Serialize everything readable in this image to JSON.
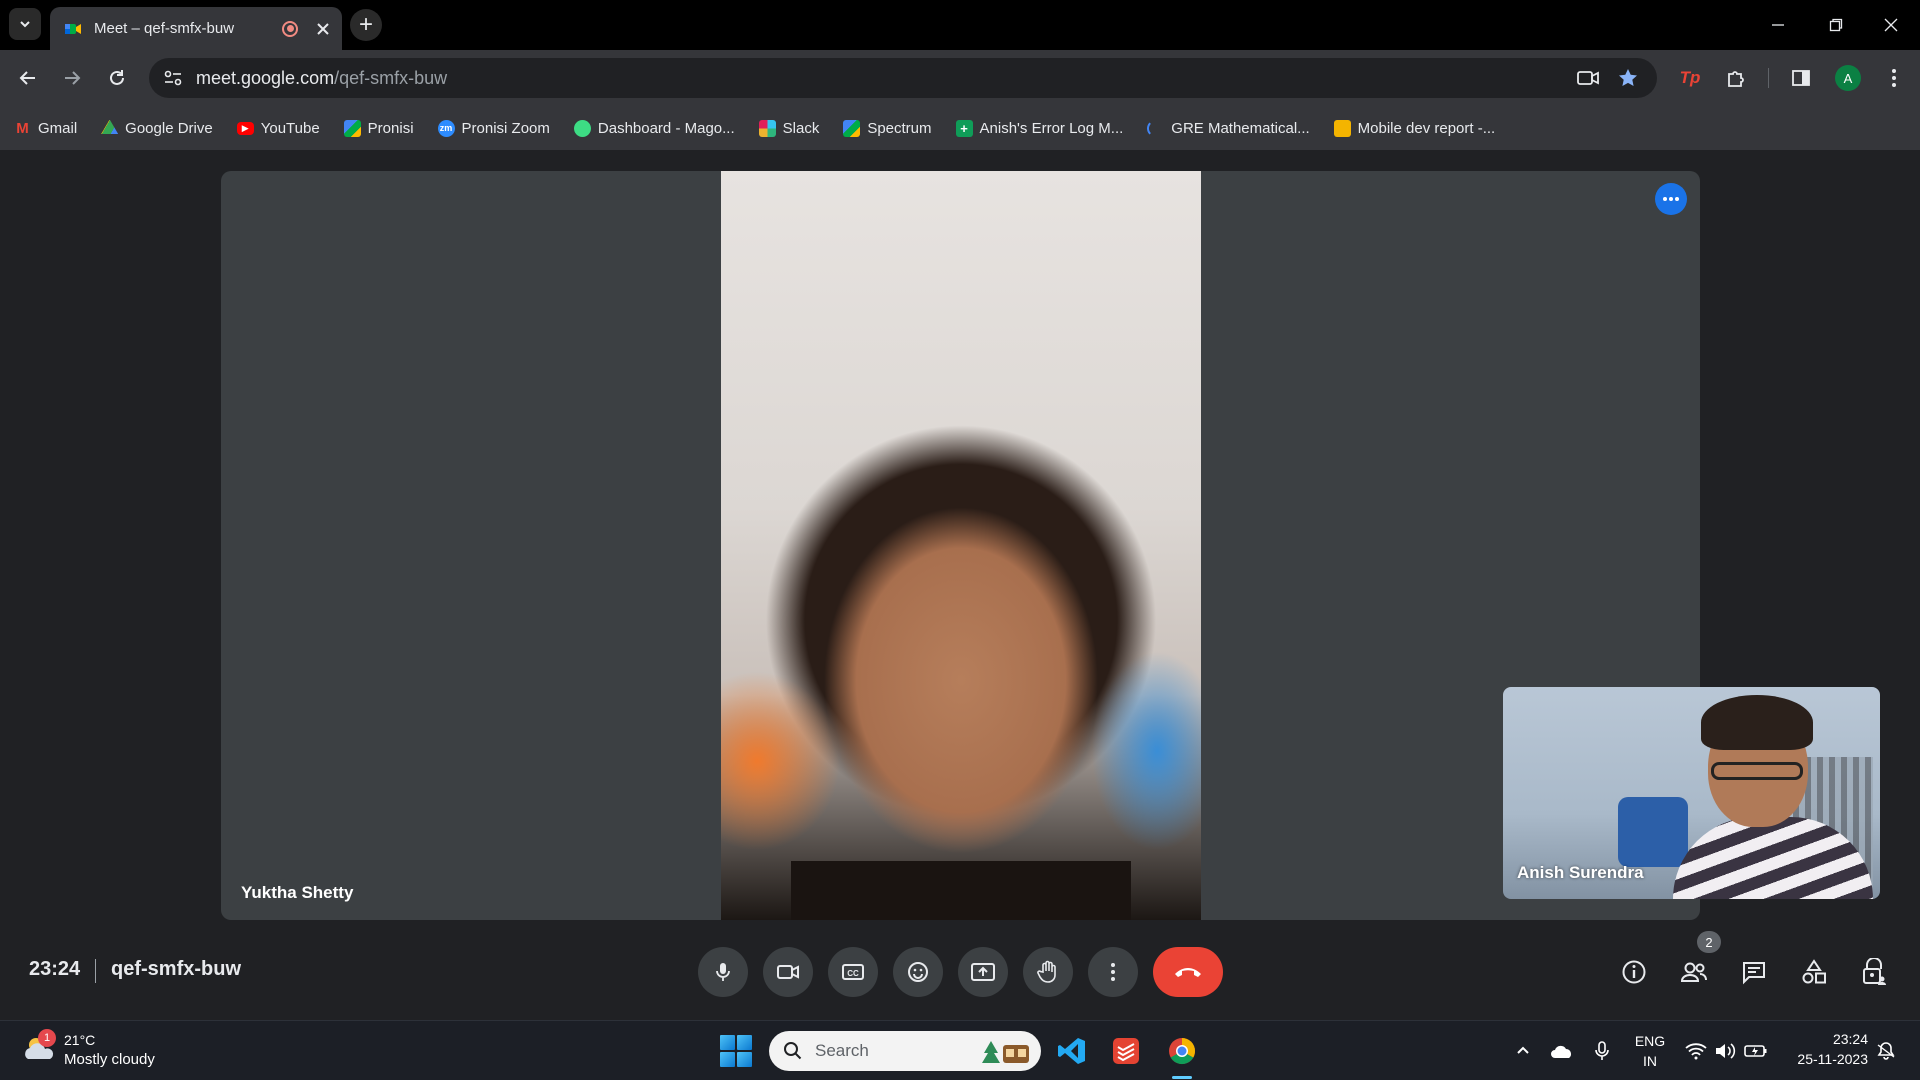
{
  "browser": {
    "tab_title": "Meet – qef-smfx-buw",
    "url_host": "meet.google.com",
    "url_path": "/qef-smfx-buw",
    "profile_initial": "A",
    "new_tab_symbol": "+",
    "tp_extension_label": "Tp"
  },
  "bookmarks": [
    {
      "label": "Gmail",
      "icon": "gmail-icon",
      "color": "#ea4335"
    },
    {
      "label": "Google Drive",
      "icon": "drive-icon",
      "color": "#34a853"
    },
    {
      "label": "YouTube",
      "icon": "youtube-icon",
      "color": "#ff0000"
    },
    {
      "label": "Pronisi",
      "icon": "meet-icon",
      "color": "#00832d"
    },
    {
      "label": "Pronisi Zoom",
      "icon": "zoom-icon",
      "color": "#2d8cff"
    },
    {
      "label": "Dashboard - Mago...",
      "icon": "dashboard-icon",
      "color": "#3ddc84"
    },
    {
      "label": "Slack",
      "icon": "slack-icon",
      "color": "#e01e5a"
    },
    {
      "label": "Spectrum",
      "icon": "meet-icon",
      "color": "#00832d"
    },
    {
      "label": "Anish's Error Log M...",
      "icon": "sheets-icon",
      "color": "#0f9d58"
    },
    {
      "label": "GRE Mathematical...",
      "icon": "loading-icon",
      "color": "#4285f4"
    },
    {
      "label": "Mobile dev report -...",
      "icon": "slides-icon",
      "color": "#f4b400"
    }
  ],
  "meet": {
    "main_participant": "Yuktha Shetty",
    "self_participant": "Anish Surendra",
    "time": "23:24",
    "meeting_code": "qef-smfx-buw",
    "people_count": "2",
    "leave_color": "#ea4335",
    "accent_color": "#1a73e8"
  },
  "taskbar": {
    "weather_temp": "21°C",
    "weather_desc": "Mostly cloudy",
    "weather_badge": "1",
    "search_label": "Search",
    "lang_line1": "ENG",
    "lang_line2": "IN",
    "clock_time": "23:24",
    "clock_date": "25-11-2023"
  }
}
